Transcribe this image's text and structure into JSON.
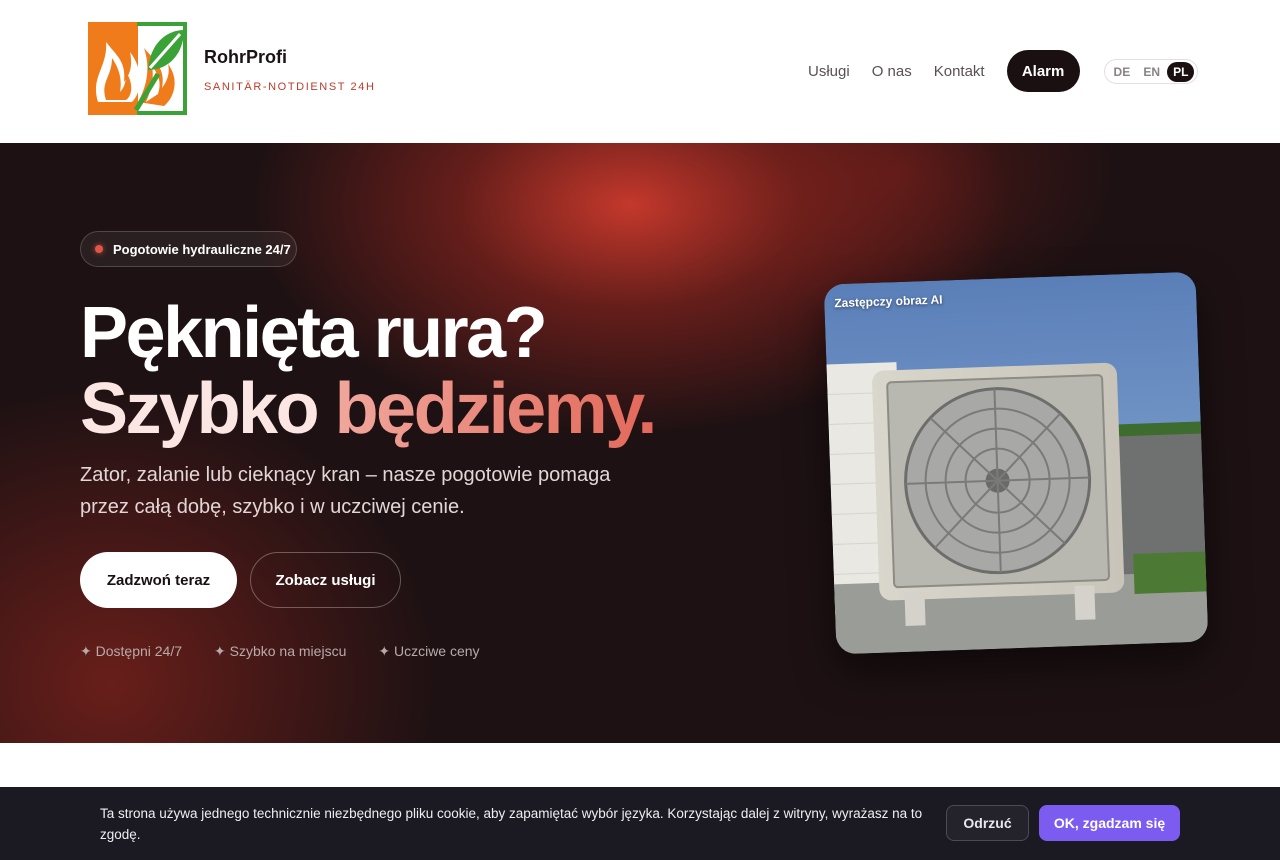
{
  "header": {
    "brand_name": "RohrProfi",
    "brand_tagline": "SANITÄR-NOTDIENST 24H",
    "nav": [
      {
        "label": "Usługi"
      },
      {
        "label": "O nas"
      },
      {
        "label": "Kontakt"
      }
    ],
    "alarm_label": "Alarm",
    "languages": [
      "DE",
      "EN",
      "PL"
    ],
    "active_language": "PL"
  },
  "hero": {
    "badge": "Pogotowie hydrauliczne 24/7",
    "headline_line1": "Pęknięta rura?",
    "headline_line2_plain": "Szybko ",
    "headline_line2_accent": "będziemy.",
    "lead": "Zator, zalanie lub cieknący kran – nasze pogotowie pomaga przez całą dobę, szybko i w uczciwej cenie.",
    "primary_button": "Zadzwoń teraz",
    "secondary_button": "Zobacz usługi",
    "features": [
      "✦ Dostępni 24/7",
      "✦ Szybko na miejscu",
      "✦ Uczciwe ceny"
    ],
    "image_label": "Zastępczy obraz AI"
  },
  "cookie_banner": {
    "text": "Ta strona używa jednego technicznie niezbędnego pliku cookie, aby zapamiętać wybór języka. Korzystając dalej z witryny, wyrażasz na to zgodę.",
    "reject_label": "Odrzuć",
    "accept_label": "OK, zgadzam się"
  },
  "colors": {
    "accent_red": "#c0392b",
    "dark_bg": "#1d1113",
    "accept_purple": "#7c5cf0"
  },
  "icons": {
    "logo": "flame-leaf-logo",
    "badge_dot": "status-dot-icon"
  }
}
